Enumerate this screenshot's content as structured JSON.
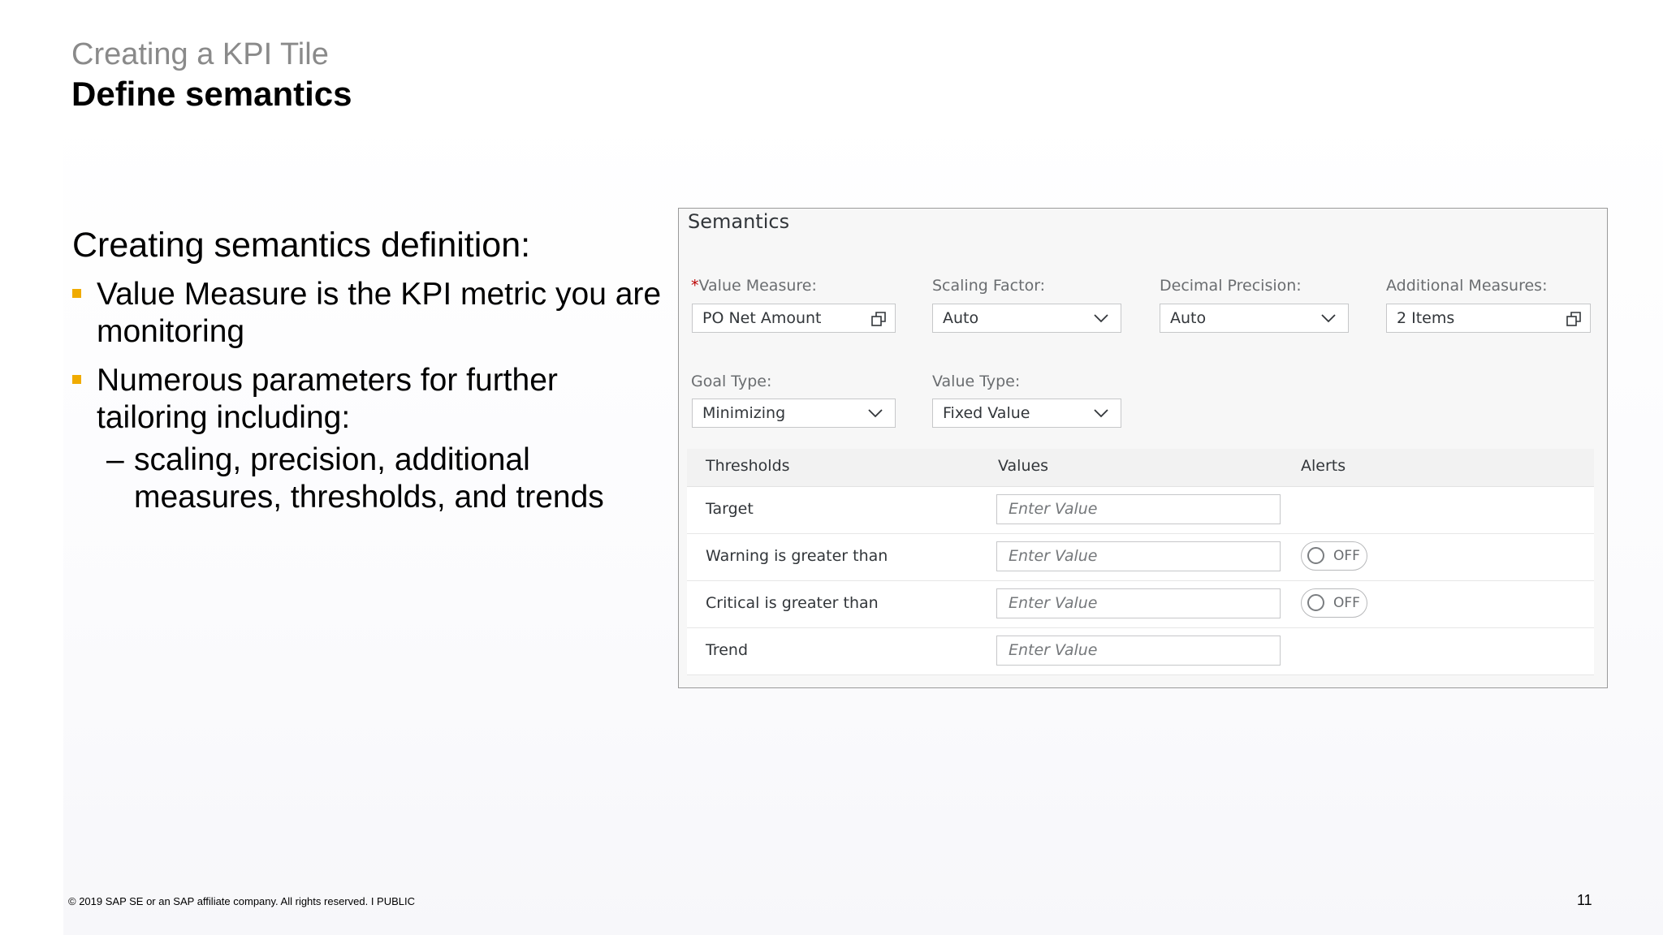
{
  "header": {
    "subtitle": "Creating a KPI Tile",
    "title": "Define semantics"
  },
  "content": {
    "heading": "Creating semantics definition:",
    "bullets": [
      {
        "line1": "Value Measure is the KPI metric you are",
        "line2": "monitoring"
      },
      {
        "line1": "Numerous parameters for further",
        "line2": "tailoring including:"
      }
    ],
    "sub_bullet": {
      "dash": "–",
      "line1": "scaling, precision, additional",
      "line2": "measures, thresholds, and trends"
    },
    "bullet_color": "#f0ab00"
  },
  "panel": {
    "title": "Semantics",
    "fields": {
      "value_measure": {
        "required_mark": "*",
        "label": "Value Measure:",
        "value": "PO Net Amount",
        "icon": "value-help-icon"
      },
      "scaling_factor": {
        "label": "Scaling Factor:",
        "value": "Auto",
        "icon": "chevron-down-icon"
      },
      "decimal_precision": {
        "label": "Decimal Precision:",
        "value": "Auto",
        "icon": "chevron-down-icon"
      },
      "additional_measures": {
        "label": "Additional Measures:",
        "value": "2 Items",
        "icon": "value-help-icon"
      },
      "goal_type": {
        "label": "Goal Type:",
        "value": "Minimizing",
        "icon": "chevron-down-icon"
      },
      "value_type": {
        "label": "Value Type:",
        "value": "Fixed Value",
        "icon": "chevron-down-icon"
      }
    },
    "table": {
      "headers": [
        "Thresholds",
        "Values",
        "Alerts"
      ],
      "rows": [
        {
          "label": "Target",
          "placeholder": "Enter Value"
        },
        {
          "label": "Warning is greater than",
          "placeholder": "Enter Value",
          "alert": "OFF"
        },
        {
          "label": "Critical is greater than",
          "placeholder": "Enter Value",
          "alert": "OFF"
        },
        {
          "label": "Trend",
          "placeholder": "Enter Value"
        }
      ]
    }
  },
  "footer": {
    "copyright": "© 2019 SAP SE or an SAP affiliate company. All rights reserved.   I   PUBLIC",
    "page_number": "11"
  }
}
